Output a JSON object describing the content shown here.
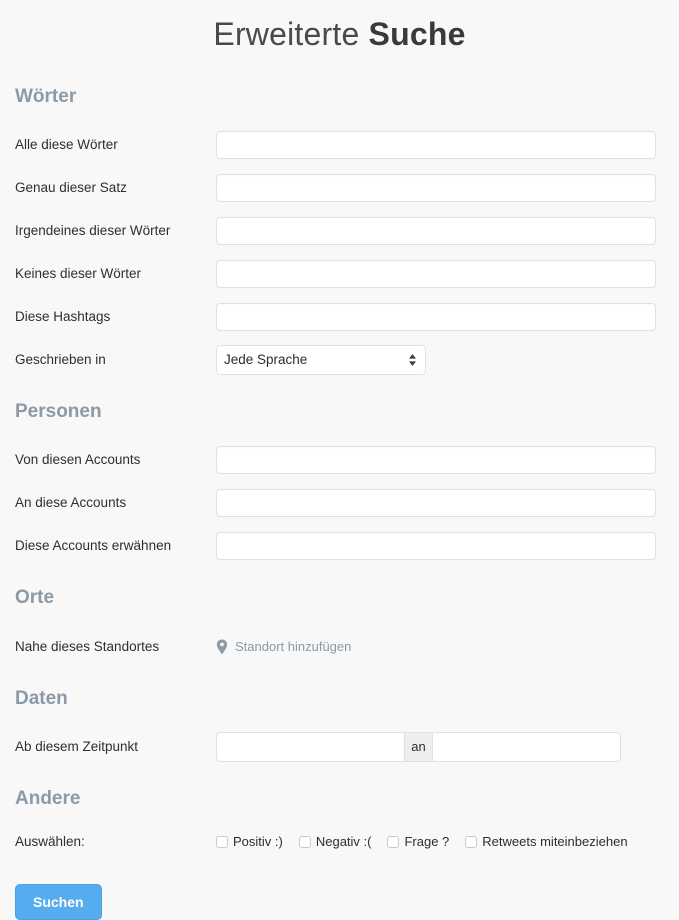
{
  "page": {
    "title_regular": "Erweiterte ",
    "title_bold": "Suche",
    "background_color": "#f8f8f8",
    "accent_color": "#55acee",
    "heading_color": "#8b9aa6",
    "label_color": "#292f33"
  },
  "sections": {
    "words": {
      "heading": "Wörter",
      "rows": [
        {
          "label": "Alle diese Wörter",
          "value": "",
          "placeholder": ""
        },
        {
          "label": "Genau dieser Satz",
          "value": "",
          "placeholder": ""
        },
        {
          "label": "Irgendeines dieser Wörter",
          "value": "",
          "placeholder": ""
        },
        {
          "label": "Keines dieser Wörter",
          "value": "",
          "placeholder": ""
        },
        {
          "label": "Diese Hashtags",
          "value": "",
          "placeholder": ""
        }
      ],
      "language": {
        "label": "Geschrieben in",
        "selected": "Jede Sprache",
        "options": [
          "Jede Sprache"
        ],
        "icon": "select-stepper-arrows-icon"
      }
    },
    "people": {
      "heading": "Personen",
      "rows": [
        {
          "label": "Von diesen Accounts",
          "value": "",
          "placeholder": ""
        },
        {
          "label": "An diese Accounts",
          "value": "",
          "placeholder": ""
        },
        {
          "label": "Diese Accounts erwähnen",
          "value": "",
          "placeholder": ""
        }
      ]
    },
    "places": {
      "heading": "Orte",
      "row_label": "Nahe dieses Standortes",
      "link_label": "Standort hinzufügen",
      "link_icon": "map-pin-icon"
    },
    "dates": {
      "heading": "Daten",
      "row_label": "Ab diesem Zeitpunkt",
      "from_value": "",
      "from_placeholder": "",
      "addon_label": "an",
      "to_value": "",
      "to_placeholder": ""
    },
    "other": {
      "heading": "Andere",
      "row_label": "Auswählen:",
      "checkboxes": [
        {
          "label": "Positiv :)",
          "checked": false
        },
        {
          "label": "Negativ :(",
          "checked": false
        },
        {
          "label": "Frage ?",
          "checked": false
        },
        {
          "label": "Retweets miteinbeziehen",
          "checked": false
        }
      ]
    }
  },
  "submit": {
    "label": "Suchen"
  }
}
